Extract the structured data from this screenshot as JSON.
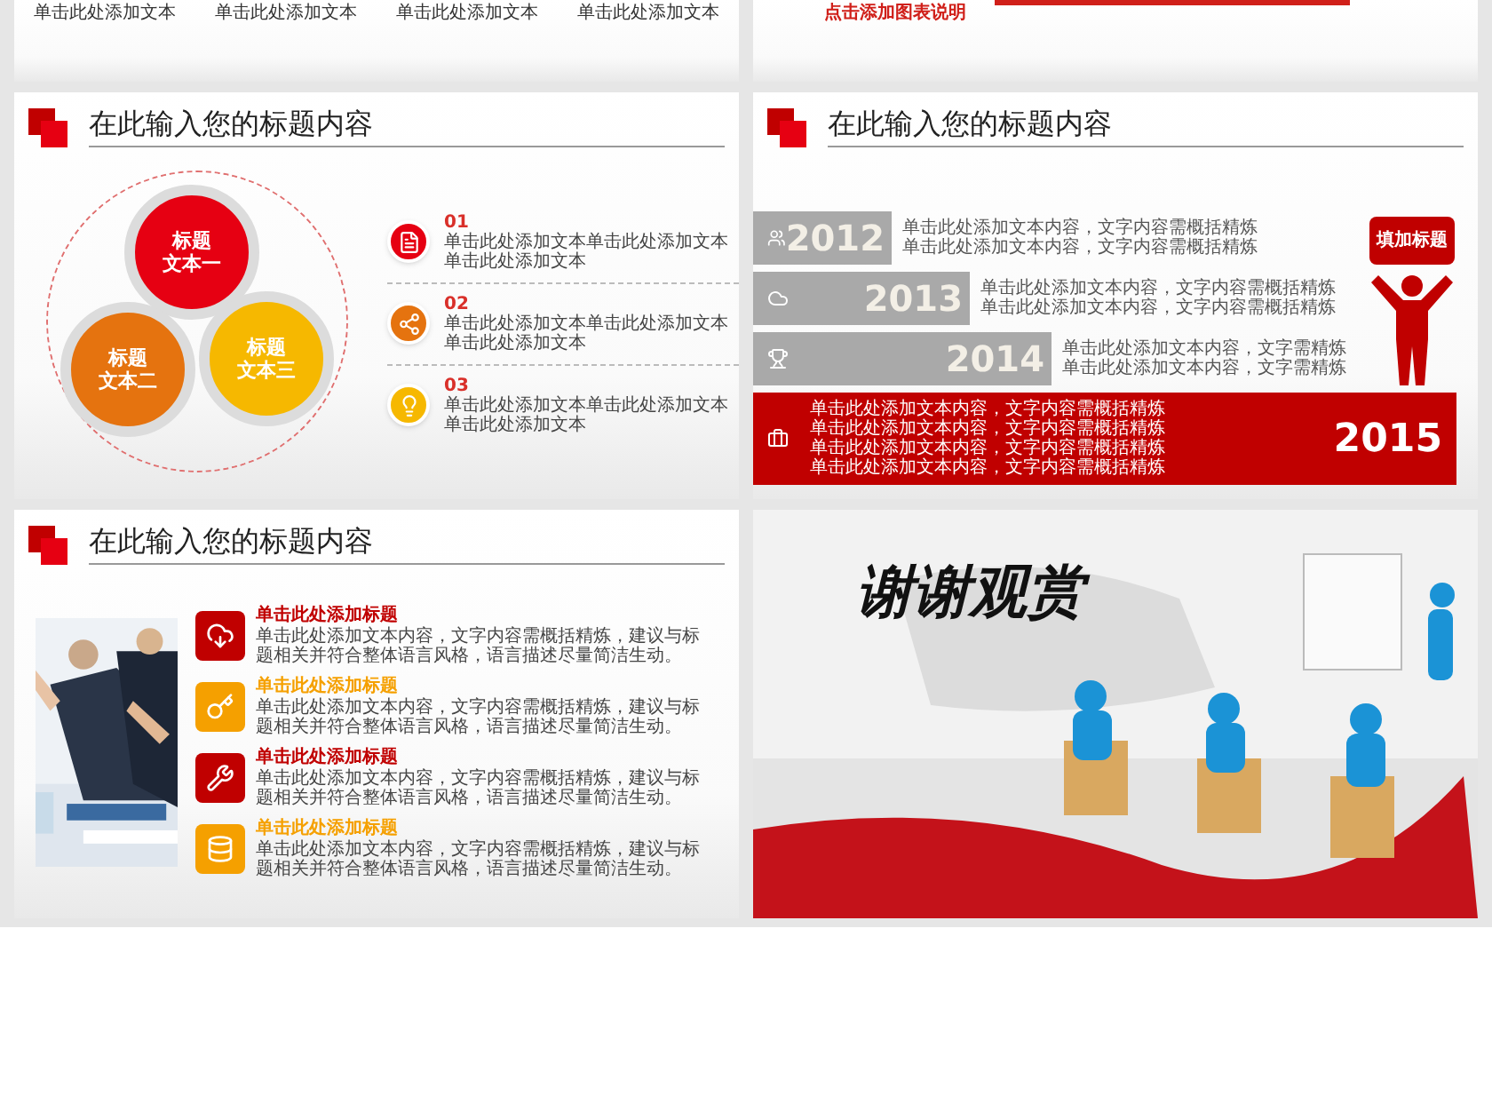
{
  "top_left_slide": {
    "labels": [
      "单击此处添加文本",
      "单击此处添加文本",
      "单击此处添加文本",
      "单击此处添加文本"
    ]
  },
  "top_right_slide": {
    "caption": "点击添加图表说明"
  },
  "circle_slide": {
    "title": "在此输入您的标题内容",
    "circles": [
      {
        "line1": "标题",
        "line2": "文本一",
        "color": "#e60012"
      },
      {
        "line1": "标题",
        "line2": "文本二",
        "color": "#e5730f"
      },
      {
        "line1": "标题",
        "line2": "文本三",
        "color": "#f6b800"
      }
    ],
    "items": [
      {
        "number": "01",
        "text": "单击此处添加文本单击此处添加文本单击此处添加文本",
        "color": "#e60012"
      },
      {
        "number": "02",
        "text": "单击此处添加文本单击此处添加文本单击此处添加文本",
        "color": "#e5730f"
      },
      {
        "number": "03",
        "text": "单击此处添加文本单击此处添加文本单击此处添加文本",
        "color": "#f6b800"
      }
    ]
  },
  "timeline_slide": {
    "title": "在此输入您的标题内容",
    "bubble": "填加标题",
    "rows": [
      {
        "kind": "bar",
        "year": "2012",
        "lines": [
          "单击此处添加文本内容，文字内容需概括精炼",
          "单击此处添加文本内容，文字内容需概括精炼"
        ]
      },
      {
        "kind": "bar",
        "year": "2013",
        "lines": [
          "单击此处添加文本内容，文字内容需概括精炼",
          "单击此处添加文本内容，文字内容需概括精炼"
        ]
      },
      {
        "kind": "bar",
        "year": "2014",
        "lines": [
          "单击此处添加文本内容，文字需精炼",
          "单击此处添加文本内容，文字需精炼"
        ]
      },
      {
        "kind": "highlight",
        "year": "2015",
        "lines": [
          "单击此处添加文本内容，文字内容需概括精炼",
          "单击此处添加文本内容，文字内容需概括精炼",
          "单击此处添加文本内容，文字内容需概括精炼",
          "单击此处添加文本内容，文字内容需概括精炼"
        ]
      }
    ]
  },
  "photo_slide": {
    "title": "在此输入您的标题内容",
    "items": [
      {
        "title": "单击此处添加标题",
        "text": "单击此处添加文本内容，文字内容需概括精炼，建议与标题相关并符合整体语言风格，语言描述尽量简洁生动。",
        "color": "#c00000"
      },
      {
        "title": "单击此处添加标题",
        "text": "单击此处添加文本内容，文字内容需概括精炼，建议与标题相关并符合整体语言风格，语言描述尽量简洁生动。",
        "color": "#f5a000"
      },
      {
        "title": "单击此处添加标题",
        "text": "单击此处添加文本内容，文字内容需概括精炼，建议与标题相关并符合整体语言风格，语言描述尽量简洁生动。",
        "color": "#c00000"
      },
      {
        "title": "单击此处添加标题",
        "text": "单击此处添加文本内容，文字内容需概括精炼，建议与标题相关并符合整体语言风格，语言描述尽量简洁生动。",
        "color": "#f5a000"
      }
    ]
  },
  "thanks_slide": {
    "title": "谢谢观赏"
  }
}
